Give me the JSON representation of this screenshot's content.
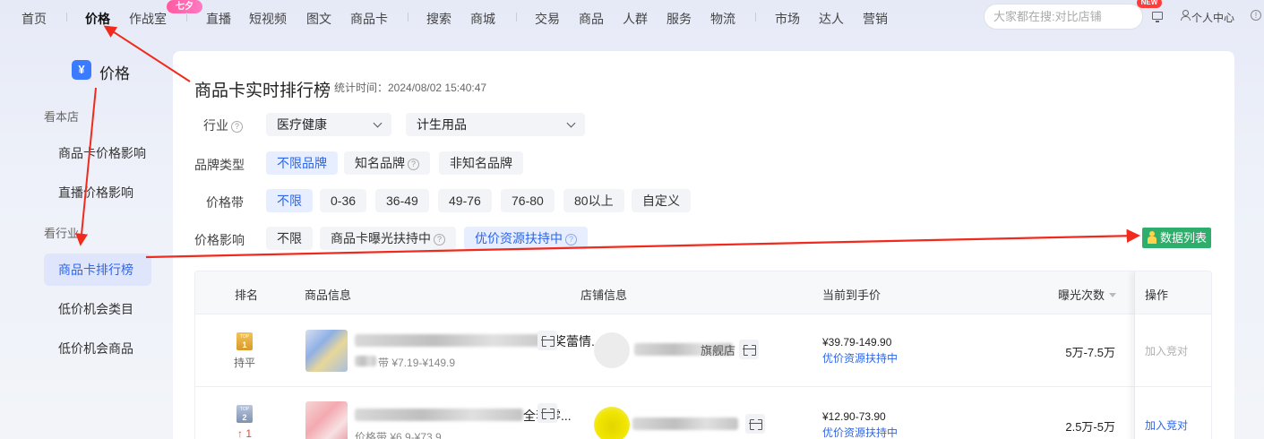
{
  "nav": {
    "items": [
      "首页",
      "价格",
      "作战室",
      "直播",
      "短视频",
      "图文",
      "商品卡",
      "搜索",
      "商城",
      "交易",
      "商品",
      "人群",
      "服务",
      "物流",
      "市场",
      "达人",
      "营销"
    ],
    "badge_seven": "七夕",
    "search_placeholder": "大家都在搜:对比店铺",
    "new_badge": "NEW",
    "user_center": "个人中心",
    "info_symbol": "!"
  },
  "sidebar": {
    "logo_glyph": "¥",
    "title": "价格",
    "group1": "看本店",
    "group2": "看行业",
    "items": [
      "商品卡价格影响",
      "直播价格影响",
      "商品卡排行榜",
      "低价机会类目",
      "低价机会商品"
    ],
    "active_index": 2
  },
  "panel": {
    "title": "商品卡实时排行榜",
    "stat_time": "统计时间：2024/08/02 15:40:47",
    "industry_label": "行业",
    "industry_value_1": "医疗健康",
    "industry_value_2": "计生用品",
    "brand_label": "品牌类型",
    "brand_options": [
      "不限品牌",
      "知名品牌",
      "非知名品牌"
    ],
    "price_band_label": "价格带",
    "price_band_options": [
      "不限",
      "0-36",
      "36-49",
      "49-76",
      "76-80",
      "80以上",
      "自定义"
    ],
    "price_effect_label": "价格影响",
    "price_effect_options": [
      "不限",
      "商品卡曝光扶持中",
      "优价资源扶持中"
    ],
    "data_list_button": "数据列表",
    "help_symbol": "?"
  },
  "table": {
    "headers": [
      "排名",
      "商品信息",
      "店铺信息",
      "当前到手价",
      "曝光次数",
      "操作"
    ],
    "rows": [
      {
        "medal_top": "TOP",
        "medal_num": "1",
        "rank_change": "持平",
        "title_tail": "奖蕾情...",
        "price_band": "带 ¥7.19-¥149.9",
        "shop_tail": "旗舰店",
        "price": "¥39.79-149.90",
        "price_tag": "优价资源扶持中",
        "exposure": "5万-7.5万",
        "action": "加入竞对"
      },
      {
        "medal_top": "TOP",
        "medal_num": "2",
        "rank_change": "↑ 1",
        "title_tail": "全套零...",
        "price_band": "价格带 ¥6.9-¥73.9",
        "shop_tail": "",
        "price": "¥12.90-73.90",
        "price_tag": "优价资源扶持中",
        "exposure": "2.5万-5万",
        "action": "加入竞对"
      }
    ]
  },
  "colors": {
    "accent": "#2f66e8",
    "green_button": "#2fae6b",
    "annotation_arrow": "#f02b1d",
    "badge_pink": "#ff5aa0"
  }
}
